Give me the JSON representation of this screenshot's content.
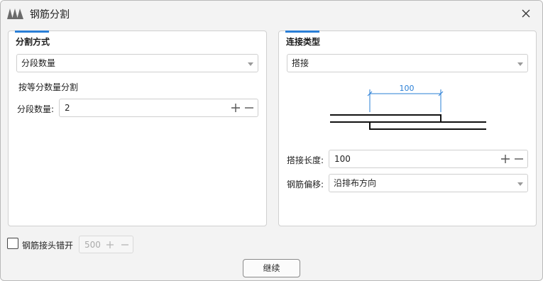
{
  "window": {
    "title": "钢筋分割",
    "icons": {
      "logo": "app-logo-icon",
      "close": "close-icon"
    }
  },
  "left_panel": {
    "heading": "分割方式",
    "mode_select": "分段数量",
    "description": "按等分数量分割",
    "segment_label": "分段数量:",
    "segment_value": "2"
  },
  "right_panel": {
    "heading": "连接类型",
    "type_select": "搭接",
    "diagram_dimension": "100",
    "lap_length_label": "搭接长度:",
    "lap_length_value": "100",
    "offset_label": "钢筋偏移:",
    "offset_select": "沿排布方向"
  },
  "bottom": {
    "stagger_label": "钢筋接头错开",
    "stagger_checked": false,
    "stagger_value": "500",
    "continue_button": "继续"
  },
  "colors": {
    "accent": "#2a7fd6",
    "dimension": "#2a7fd6"
  }
}
